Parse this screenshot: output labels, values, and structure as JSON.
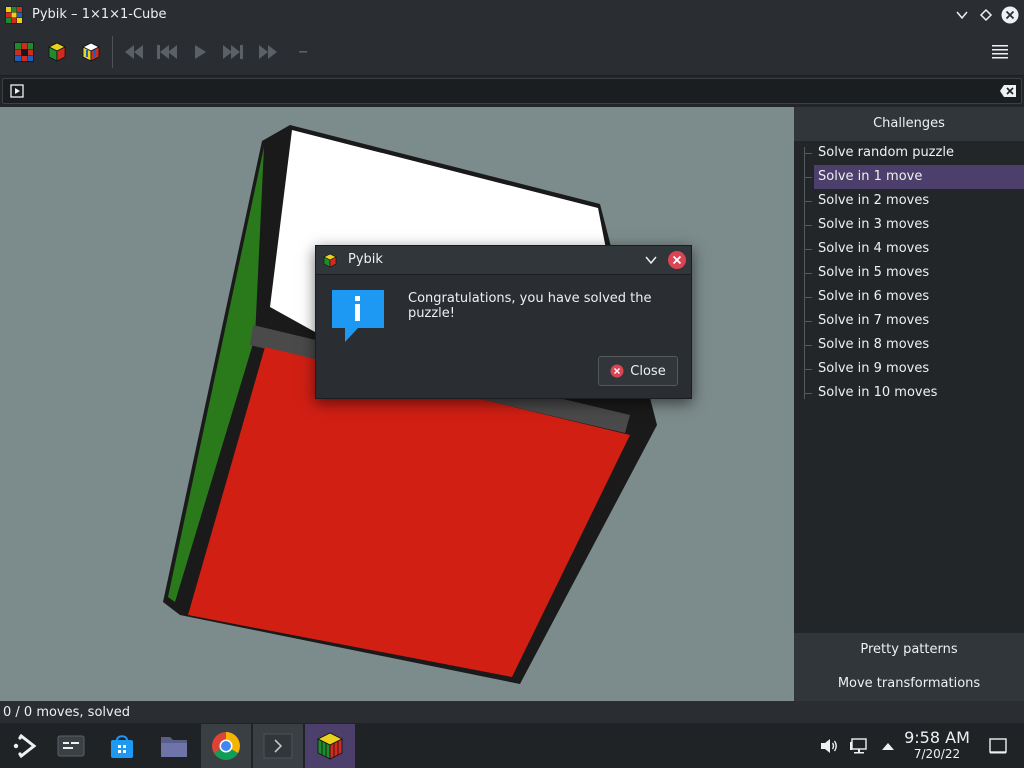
{
  "window": {
    "title": "Pybik – 1×1×1-Cube"
  },
  "toolbar": {
    "items": [
      "new-puzzle-icon",
      "solved-puzzle-icon",
      "random-puzzle-icon",
      "rewind-icon",
      "previous-icon",
      "play-icon",
      "next-icon",
      "forward-icon",
      "minus-icon"
    ],
    "menu_icon": "hamburger-menu-icon"
  },
  "command_field": {
    "value": ""
  },
  "sidebar": {
    "header": "Challenges",
    "items": [
      "Solve random puzzle",
      "Solve in 1 move",
      "Solve in 2 moves",
      "Solve in 3 moves",
      "Solve in 4 moves",
      "Solve in 5 moves",
      "Solve in 6 moves",
      "Solve in 7 moves",
      "Solve in 8 moves",
      "Solve in 9 moves",
      "Solve in 10 moves"
    ],
    "selected_index": 1,
    "buttons": [
      "Pretty patterns",
      "Move transformations"
    ]
  },
  "status": {
    "text": "0 / 0 moves, solved"
  },
  "dialog": {
    "title": "Pybik",
    "message": "Congratulations, you have solved the puzzle!",
    "close_label": "Close",
    "icon": "info-icon"
  },
  "taskbar": {
    "apps": [
      "app-launcher-icon",
      "task-switcher-icon",
      "discover-store-icon",
      "file-manager-icon",
      "chrome-icon",
      "terminal-icon",
      "pybik-icon"
    ],
    "tray": [
      "volume-icon",
      "network-icon",
      "tray-expand-icon"
    ],
    "time": "9:58 AM",
    "date": "7/20/22",
    "show_desktop_icon": "show-desktop-icon"
  },
  "cube_colors": {
    "top": "#ffffff",
    "front": "#d11f14",
    "left": "#2a7a1c",
    "edge": "#1a1a1a",
    "background": "#7c8b8b"
  }
}
